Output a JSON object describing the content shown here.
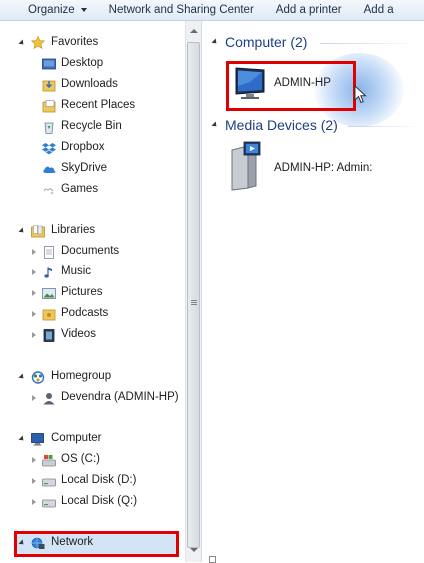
{
  "toolbar": {
    "items": [
      {
        "label": "Organize"
      },
      {
        "label": "Network and Sharing Center"
      },
      {
        "label": "Add a printer"
      },
      {
        "label": "Add a"
      }
    ]
  },
  "nav": {
    "favorites": {
      "label": "Favorites",
      "items": [
        {
          "label": "Desktop"
        },
        {
          "label": "Downloads"
        },
        {
          "label": "Recent Places"
        },
        {
          "label": "Recycle Bin"
        },
        {
          "label": "Dropbox"
        },
        {
          "label": "SkyDrive"
        },
        {
          "label": "Games"
        }
      ]
    },
    "libraries": {
      "label": "Libraries",
      "items": [
        {
          "label": "Documents"
        },
        {
          "label": "Music"
        },
        {
          "label": "Pictures"
        },
        {
          "label": "Podcasts"
        },
        {
          "label": "Videos"
        }
      ]
    },
    "homegroup": {
      "label": "Homegroup",
      "items": [
        {
          "label": "Devendra (ADMIN-HP)"
        }
      ]
    },
    "computer": {
      "label": "Computer",
      "items": [
        {
          "label": "OS (C:)"
        },
        {
          "label": "Local Disk (D:)"
        },
        {
          "label": "Local Disk (Q:)"
        }
      ]
    },
    "network": {
      "label": "Network"
    }
  },
  "content": {
    "groups": [
      {
        "header": "Computer (2)",
        "items": [
          {
            "label": "ADMIN-HP"
          }
        ]
      },
      {
        "header": "Media Devices (2)",
        "items": [
          {
            "label": "ADMIN-HP: Admin:"
          }
        ]
      }
    ]
  },
  "colors": {
    "group_header": "#1e3f84",
    "highlight_box": "#e00000",
    "selection": "#d4e4f7"
  }
}
